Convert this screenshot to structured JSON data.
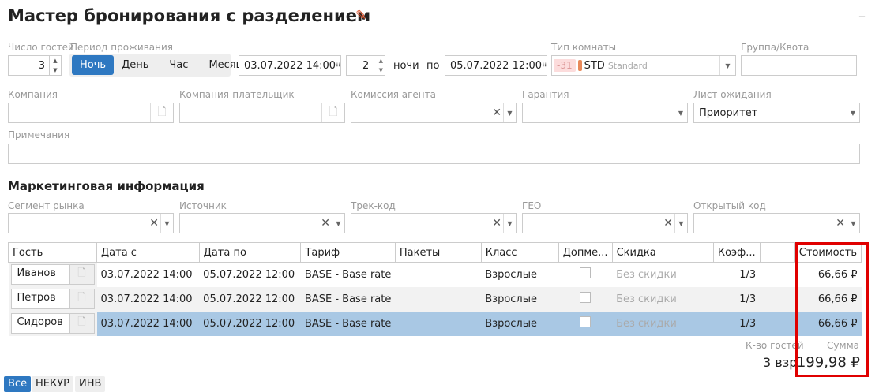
{
  "title": "Мастер бронирования с разделением",
  "icons": {
    "edit": "pencil-icon",
    "minimize": "minimize-icon",
    "calendar": "grid-icon",
    "doc": "document-icon",
    "clear": "x-icon",
    "dropdown": "caret-down-icon"
  },
  "colors": {
    "accent": "#2e78c1",
    "selected_row": "#a9c8e4",
    "highlight_box": "#e00000",
    "room_badge": "#e8895a"
  },
  "row1": {
    "guests_label": "Число гостей",
    "guests_value": "3",
    "period_label": "Период проживания",
    "period_options": [
      "Ночь",
      "День",
      "Час",
      "Месяц"
    ],
    "period_selected": "Ночь",
    "date_from": "03.07.2022 14:00",
    "nights": "2",
    "nights_label": "ночи",
    "to_label": "по",
    "date_to": "05.07.2022 12:00",
    "room_type_label": "Тип комнаты",
    "room_avail": "-31",
    "room_code": "STD",
    "room_name": "Standard",
    "group_label": "Группа/Квота",
    "group_value": ""
  },
  "row2": {
    "company": "Компания",
    "payer": "Компания-плательщик",
    "commission": "Комиссия агента",
    "guarantee": "Гарантия",
    "waitlist": "Лист ожидания",
    "waitlist_value": "Приоритет"
  },
  "notes_label": "Примечания",
  "marketing": {
    "title": "Маркетинговая информация",
    "fields": [
      "Сегмент рынка",
      "Источник",
      "Трек-код",
      "ГЕО",
      "Открытый код"
    ]
  },
  "table": {
    "headers": [
      "Гость",
      "Дата с",
      "Дата по",
      "Тариф",
      "Пакеты",
      "Класс",
      "Допме...",
      "Скидка",
      "Коэф...",
      "",
      "Стоимость"
    ],
    "rows": [
      {
        "guest": "Иванов",
        "from": "03.07.2022 14:00",
        "to": "05.07.2022 12:00",
        "rate": "BASE - Base rate",
        "packages": "",
        "class": "Взрослые",
        "extra_bed": false,
        "discount": "Без скидки",
        "coef": "1/3",
        "cost": "66,66 ₽"
      },
      {
        "guest": "Петров",
        "from": "03.07.2022 14:00",
        "to": "05.07.2022 12:00",
        "rate": "BASE - Base rate",
        "packages": "",
        "class": "Взрослые",
        "extra_bed": false,
        "discount": "Без скидки",
        "coef": "1/3",
        "cost": "66,66 ₽"
      },
      {
        "guest": "Сидоров",
        "from": "03.07.2022 14:00",
        "to": "05.07.2022 12:00",
        "rate": "BASE - Base rate",
        "packages": "",
        "class": "Взрослые",
        "extra_bed": false,
        "discount": "Без скидки",
        "coef": "1/3",
        "cost": "66,66 ₽"
      }
    ]
  },
  "totals": {
    "guests_label": "К-во гостей",
    "guests_value": "3 взр",
    "sum_label": "Сумма",
    "sum_value": "199,98 ₽"
  },
  "filter_tabs": [
    "Все",
    "НЕКУР",
    "ИНВ"
  ]
}
